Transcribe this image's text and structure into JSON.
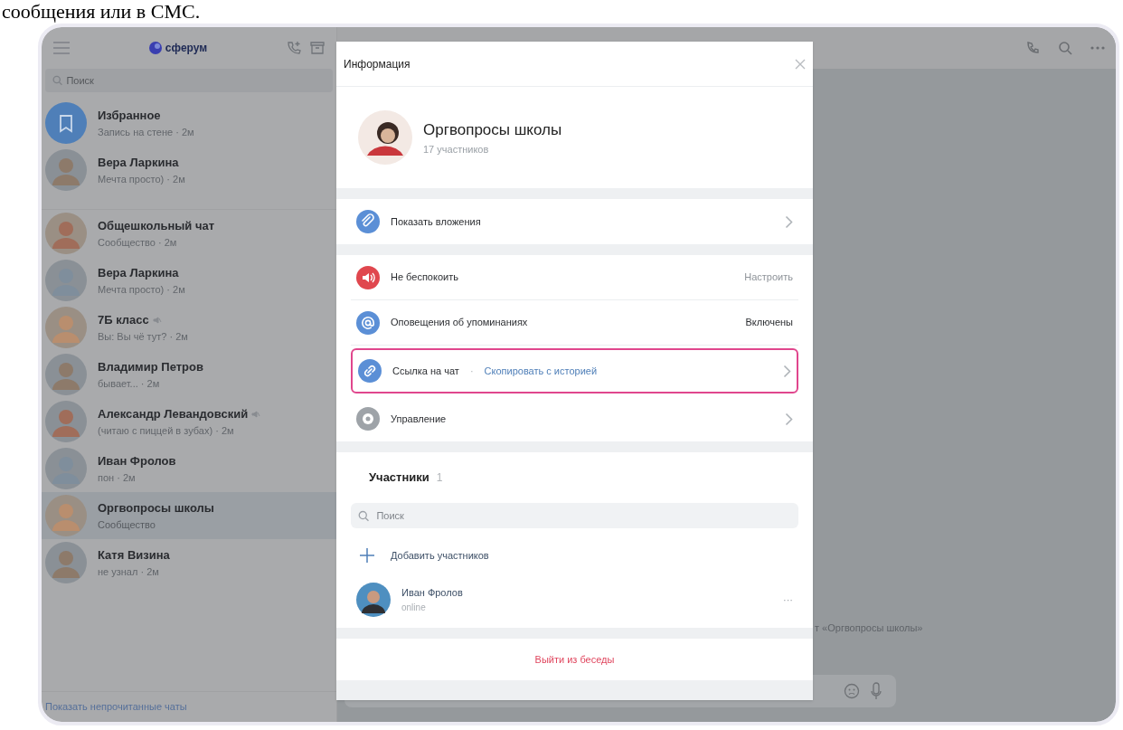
{
  "caption": "сообщения или в СМС.",
  "sidebar": {
    "logo": "сферум",
    "search": {
      "placeholder": "Поиск"
    },
    "chats": [
      {
        "name": "Избранное",
        "preview": "Запись на стене · 2м",
        "kind": "bookmark",
        "muted": false,
        "selected": false,
        "divider_after": false
      },
      {
        "name": "Вера Ларкина",
        "preview": "Мечта просто) · 2м",
        "kind": "person",
        "muted": false,
        "selected": false,
        "divider_after": true
      },
      {
        "name": "Общешкольный чат",
        "preview": "Сообщество · 2м",
        "kind": "group",
        "muted": false,
        "selected": false,
        "divider_after": false
      },
      {
        "name": "Вера Ларкина",
        "preview": "Мечта просто) · 2м",
        "kind": "person",
        "muted": false,
        "selected": false,
        "divider_after": false
      },
      {
        "name": "7Б класс",
        "preview": "Вы: Вы чё тут? · 2м",
        "kind": "group",
        "muted": true,
        "selected": false,
        "divider_after": false
      },
      {
        "name": "Владимир Петров",
        "preview": "бывает... · 2м",
        "kind": "person",
        "muted": false,
        "selected": false,
        "divider_after": false
      },
      {
        "name": "Александр Левандовский",
        "preview": "(читаю с пиццей в зубах) · 2м",
        "kind": "person",
        "muted": true,
        "selected": false,
        "divider_after": false
      },
      {
        "name": "Иван Фролов",
        "preview": "пон · 2м",
        "kind": "person",
        "muted": false,
        "selected": false,
        "divider_after": false
      },
      {
        "name": "Оргвопросы школы",
        "preview": "Сообщество",
        "kind": "group",
        "muted": false,
        "selected": true,
        "divider_after": false
      },
      {
        "name": "Катя Визина",
        "preview": "не узнал · 2м",
        "kind": "person",
        "muted": false,
        "selected": false,
        "divider_after": false
      }
    ],
    "footer_link": "Показать непрочитанные чаты"
  },
  "chat": {
    "notice": "т «Оргвопросы школы»"
  },
  "dialog": {
    "title": "Информация",
    "chat_name": "Оргвопросы школы",
    "members_count": "17 участников",
    "sections": [
      [
        {
          "label": "Показать вложения",
          "color": "#5b8fd6",
          "chevron": true,
          "highlighted": false
        }
      ],
      [
        {
          "label": "Не беспокоить",
          "color": "#e0474e",
          "value": "Настроить",
          "value_dim": true,
          "chevron": false,
          "highlighted": false
        },
        {
          "label": "Оповещения об упоминаниях",
          "color": "#5b8fd6",
          "value": "Включены",
          "value_dim": false,
          "chevron": false,
          "highlighted": false
        },
        {
          "label": "Ссылка на чат",
          "separator": "·",
          "link": "Скопировать с историей",
          "color": "#5b8fd6",
          "chevron": true,
          "highlighted": true
        },
        {
          "label": "Управление",
          "color": "#9ea3a8",
          "chevron": true,
          "highlighted": false
        }
      ]
    ],
    "members": {
      "title": "Участники",
      "count": "1",
      "search": {
        "placeholder": "Поиск"
      },
      "add": "Добавить участников",
      "list": [
        {
          "name": "Иван Фролов",
          "status": "online",
          "more": "···"
        }
      ]
    },
    "leave": "Выйти из беседы"
  }
}
